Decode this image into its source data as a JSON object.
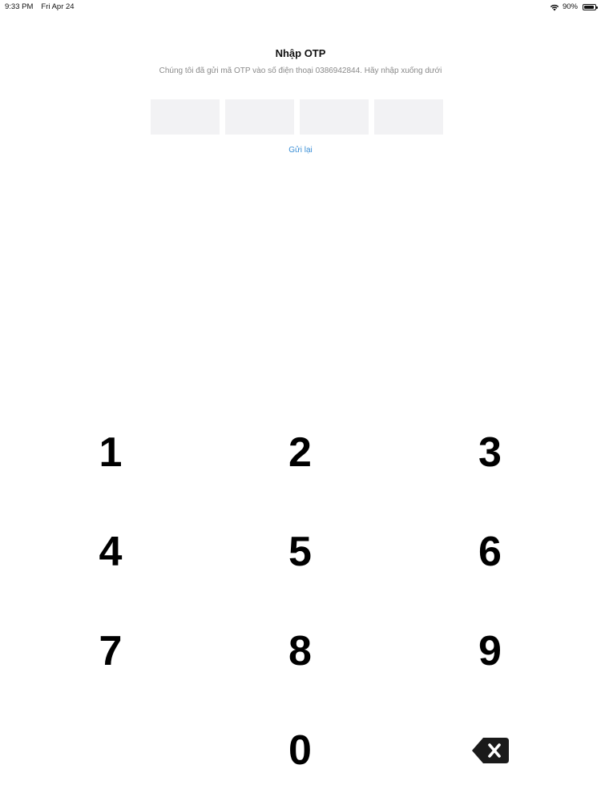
{
  "status_bar": {
    "time": "9:33 PM",
    "date": "Fri Apr 24",
    "battery_percent": "90%",
    "battery_level": 0.9,
    "icons": [
      "wifi-icon",
      "battery-icon"
    ]
  },
  "screen": {
    "title": "Nhập OTP",
    "subtitle": "Chúng tôi đã gửi mã OTP vào số điện thoại 0386942844. Hãy nhập xuống dưới",
    "otp_digits": [
      "",
      "",
      "",
      ""
    ],
    "resend_label": "Gửi lại"
  },
  "keypad": {
    "keys": [
      "1",
      "2",
      "3",
      "4",
      "5",
      "6",
      "7",
      "8",
      "9",
      "",
      "0",
      "backspace-icon"
    ]
  },
  "colors": {
    "accent": "#3b8fd6",
    "otp_box_bg": "#f2f2f4",
    "subtitle_text": "#8a8a8a",
    "backspace_bg": "#1a1a1a"
  }
}
